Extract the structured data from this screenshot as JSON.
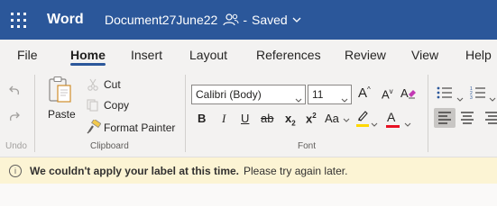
{
  "titlebar": {
    "app_name": "Word",
    "doc_name": "Document27June22",
    "separator": "-",
    "status": "Saved"
  },
  "tabs": [
    {
      "label": "File"
    },
    {
      "label": "Home"
    },
    {
      "label": "Insert"
    },
    {
      "label": "Layout"
    },
    {
      "label": "References"
    },
    {
      "label": "Review"
    },
    {
      "label": "View"
    },
    {
      "label": "Help"
    }
  ],
  "active_tab": "Home",
  "ribbon": {
    "undo_label": "Undo",
    "clipboard": {
      "paste": "Paste",
      "cut": "Cut",
      "copy": "Copy",
      "format_painter": "Format Painter",
      "group_label": "Clipboard"
    },
    "font": {
      "font_name": "Calibri (Body)",
      "font_size": "11",
      "group_label": "Font",
      "bold": "B",
      "italic": "I",
      "underline": "U",
      "strikethrough": "ab",
      "subscript_base": "x",
      "subscript_sub": "2",
      "superscript_base": "x",
      "superscript_sup": "2",
      "change_case": "Aa",
      "grow": "A",
      "shrink": "A",
      "font_color": "A"
    }
  },
  "colors": {
    "brand": "#2b579a",
    "highlight": "#ffd800",
    "font_color": "#e81123"
  },
  "notification": {
    "title": "We couldn't apply your label at this time.",
    "message": "Please try again later."
  }
}
